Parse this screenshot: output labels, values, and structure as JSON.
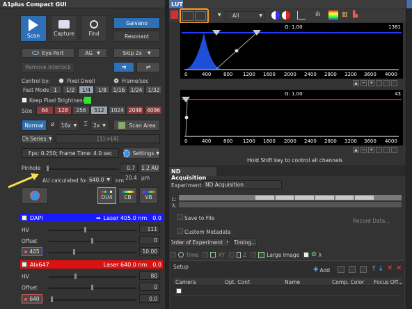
{
  "left": {
    "title": "A1plus Compact GUI",
    "scan_label": "Scan",
    "capture_label": "Capture",
    "find_label": "Find",
    "galvano_label": "Galvano",
    "resonant_label": "Resonant",
    "eyeport_label": "Eye Port",
    "ag_label": "AG",
    "skip_label": "Skip 2x",
    "remove_interlock_label": "Remove Interlock",
    "control_by_label": "Control by:",
    "pixel_dwell_label": "Pixel Dwell",
    "frame_sec_label": "Frame/sec",
    "fast_mode_label": "Fast Mode",
    "fast_mode_options": [
      "1",
      "1/2",
      "1/4",
      "1/8",
      "1/16",
      "1/24",
      "1/32"
    ],
    "fast_mode_selected": "1/4",
    "keep_brightness_label": "Keep Pixel Brightness",
    "size_label": "Size",
    "size_options": [
      "64",
      "128",
      "256",
      "512",
      "1024",
      "2048",
      "4096"
    ],
    "size_selected": "512",
    "normal_label": "Normal",
    "zoom_value": "16x",
    "sum_value": "2x",
    "scan_area_label": "Scan Area",
    "ch_series_label": "Ch Series",
    "ch_series_value": "[1]->[4]",
    "fps_text": "Fps: 0.250; Frame Time: 4.0 sec",
    "settings_label": "Settings",
    "pinhole_label": "Pinhole",
    "pinhole_value": "0.7",
    "pinhole_au": "1.2 AU",
    "pinhole_um": "20.4",
    "um_unit": "µm",
    "au_calc_label": "AU calculated for:",
    "au_calc_value": "640.0",
    "nm_unit": "nm",
    "du4_label": "DU4",
    "cb_label": "CB",
    "vb_label": "VB",
    "ch1": {
      "name": "DAPI",
      "laser": "Laser 405.0 nm",
      "laser_value": "0.0",
      "color": "#1a1aff",
      "hv_label": "HV",
      "hv_value": "111",
      "offset_label": "Offset",
      "offset_value": "0",
      "wavelength": "405",
      "power_value": "10.00"
    },
    "ch2": {
      "name": "Alx647",
      "laser": "Laser 640.0 nm",
      "laser_value": "0.0",
      "color": "#dd1111",
      "hv_label": "HV",
      "hv_value": "80",
      "offset_label": "Offset",
      "offset_value": "0",
      "wavelength": "640",
      "power_value": "0.0"
    }
  },
  "lut": {
    "title": "LUT",
    "all_label": "All",
    "plot1": {
      "gamma": "G: 1.00",
      "max_label": "1381",
      "ticks": [
        "0",
        "400",
        "800",
        "1200",
        "1600",
        "2000",
        "2400",
        "2800",
        "3200",
        "3600",
        "4000"
      ]
    },
    "plot2": {
      "gamma": "G: 1.00",
      "max_label": "43",
      "ticks": [
        "0",
        "400",
        "800",
        "1200",
        "1600",
        "2000",
        "2400",
        "2800",
        "3200",
        "3600",
        "4000"
      ]
    },
    "shift_hint": "Hold Shift key to control all channels"
  },
  "nd": {
    "title": "ND Acquisition",
    "experiment_label": "Experiment:",
    "experiment_value": "ND Acquisition",
    "l_label": "L:",
    "lambda_label": "λ:",
    "save_to_file_label": "Save to File",
    "record_data_label": "Record Data...",
    "custom_metadata_label": "Custom Metadata",
    "order_label": "Order of Experiment",
    "timing_label": "Timing...",
    "tab_time": "Time",
    "tab_xy": "XY",
    "tab_z": "Z",
    "tab_large": "Large Image",
    "tab_lambda": "λ",
    "setup_label": "Setup",
    "add_label": "Add",
    "columns": [
      "Camera",
      "Opt. Conf.",
      "Name",
      "Comp. Color",
      "Focus Off..."
    ]
  }
}
